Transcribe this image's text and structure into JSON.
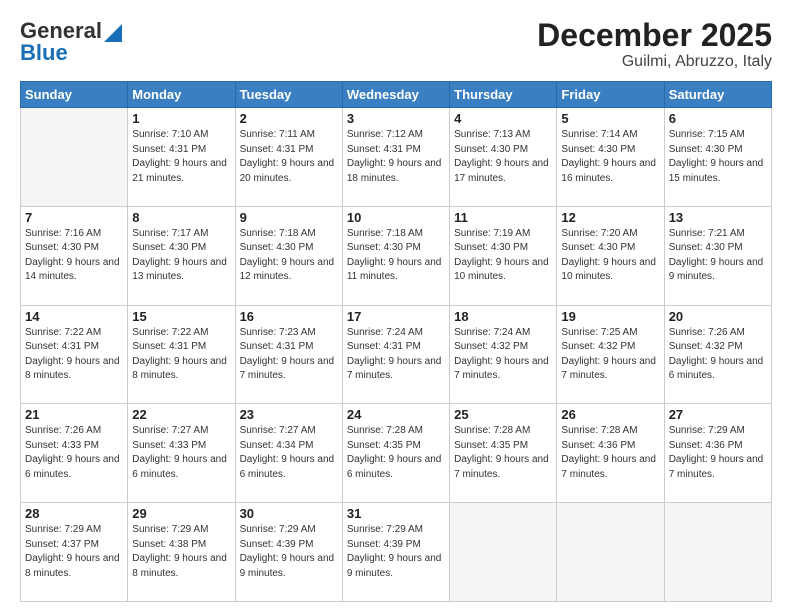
{
  "header": {
    "logo_general": "General",
    "logo_blue": "Blue",
    "title": "December 2025",
    "subtitle": "Guilmi, Abruzzo, Italy"
  },
  "days_of_week": [
    "Sunday",
    "Monday",
    "Tuesday",
    "Wednesday",
    "Thursday",
    "Friday",
    "Saturday"
  ],
  "weeks": [
    [
      {
        "day": "",
        "sunrise": "",
        "sunset": "",
        "daylight": ""
      },
      {
        "day": "1",
        "sunrise": "Sunrise: 7:10 AM",
        "sunset": "Sunset: 4:31 PM",
        "daylight": "Daylight: 9 hours and 21 minutes."
      },
      {
        "day": "2",
        "sunrise": "Sunrise: 7:11 AM",
        "sunset": "Sunset: 4:31 PM",
        "daylight": "Daylight: 9 hours and 20 minutes."
      },
      {
        "day": "3",
        "sunrise": "Sunrise: 7:12 AM",
        "sunset": "Sunset: 4:31 PM",
        "daylight": "Daylight: 9 hours and 18 minutes."
      },
      {
        "day": "4",
        "sunrise": "Sunrise: 7:13 AM",
        "sunset": "Sunset: 4:30 PM",
        "daylight": "Daylight: 9 hours and 17 minutes."
      },
      {
        "day": "5",
        "sunrise": "Sunrise: 7:14 AM",
        "sunset": "Sunset: 4:30 PM",
        "daylight": "Daylight: 9 hours and 16 minutes."
      },
      {
        "day": "6",
        "sunrise": "Sunrise: 7:15 AM",
        "sunset": "Sunset: 4:30 PM",
        "daylight": "Daylight: 9 hours and 15 minutes."
      }
    ],
    [
      {
        "day": "7",
        "sunrise": "Sunrise: 7:16 AM",
        "sunset": "Sunset: 4:30 PM",
        "daylight": "Daylight: 9 hours and 14 minutes."
      },
      {
        "day": "8",
        "sunrise": "Sunrise: 7:17 AM",
        "sunset": "Sunset: 4:30 PM",
        "daylight": "Daylight: 9 hours and 13 minutes."
      },
      {
        "day": "9",
        "sunrise": "Sunrise: 7:18 AM",
        "sunset": "Sunset: 4:30 PM",
        "daylight": "Daylight: 9 hours and 12 minutes."
      },
      {
        "day": "10",
        "sunrise": "Sunrise: 7:18 AM",
        "sunset": "Sunset: 4:30 PM",
        "daylight": "Daylight: 9 hours and 11 minutes."
      },
      {
        "day": "11",
        "sunrise": "Sunrise: 7:19 AM",
        "sunset": "Sunset: 4:30 PM",
        "daylight": "Daylight: 9 hours and 10 minutes."
      },
      {
        "day": "12",
        "sunrise": "Sunrise: 7:20 AM",
        "sunset": "Sunset: 4:30 PM",
        "daylight": "Daylight: 9 hours and 10 minutes."
      },
      {
        "day": "13",
        "sunrise": "Sunrise: 7:21 AM",
        "sunset": "Sunset: 4:30 PM",
        "daylight": "Daylight: 9 hours and 9 minutes."
      }
    ],
    [
      {
        "day": "14",
        "sunrise": "Sunrise: 7:22 AM",
        "sunset": "Sunset: 4:31 PM",
        "daylight": "Daylight: 9 hours and 8 minutes."
      },
      {
        "day": "15",
        "sunrise": "Sunrise: 7:22 AM",
        "sunset": "Sunset: 4:31 PM",
        "daylight": "Daylight: 9 hours and 8 minutes."
      },
      {
        "day": "16",
        "sunrise": "Sunrise: 7:23 AM",
        "sunset": "Sunset: 4:31 PM",
        "daylight": "Daylight: 9 hours and 7 minutes."
      },
      {
        "day": "17",
        "sunrise": "Sunrise: 7:24 AM",
        "sunset": "Sunset: 4:31 PM",
        "daylight": "Daylight: 9 hours and 7 minutes."
      },
      {
        "day": "18",
        "sunrise": "Sunrise: 7:24 AM",
        "sunset": "Sunset: 4:32 PM",
        "daylight": "Daylight: 9 hours and 7 minutes."
      },
      {
        "day": "19",
        "sunrise": "Sunrise: 7:25 AM",
        "sunset": "Sunset: 4:32 PM",
        "daylight": "Daylight: 9 hours and 7 minutes."
      },
      {
        "day": "20",
        "sunrise": "Sunrise: 7:26 AM",
        "sunset": "Sunset: 4:32 PM",
        "daylight": "Daylight: 9 hours and 6 minutes."
      }
    ],
    [
      {
        "day": "21",
        "sunrise": "Sunrise: 7:26 AM",
        "sunset": "Sunset: 4:33 PM",
        "daylight": "Daylight: 9 hours and 6 minutes."
      },
      {
        "day": "22",
        "sunrise": "Sunrise: 7:27 AM",
        "sunset": "Sunset: 4:33 PM",
        "daylight": "Daylight: 9 hours and 6 minutes."
      },
      {
        "day": "23",
        "sunrise": "Sunrise: 7:27 AM",
        "sunset": "Sunset: 4:34 PM",
        "daylight": "Daylight: 9 hours and 6 minutes."
      },
      {
        "day": "24",
        "sunrise": "Sunrise: 7:28 AM",
        "sunset": "Sunset: 4:35 PM",
        "daylight": "Daylight: 9 hours and 6 minutes."
      },
      {
        "day": "25",
        "sunrise": "Sunrise: 7:28 AM",
        "sunset": "Sunset: 4:35 PM",
        "daylight": "Daylight: 9 hours and 7 minutes."
      },
      {
        "day": "26",
        "sunrise": "Sunrise: 7:28 AM",
        "sunset": "Sunset: 4:36 PM",
        "daylight": "Daylight: 9 hours and 7 minutes."
      },
      {
        "day": "27",
        "sunrise": "Sunrise: 7:29 AM",
        "sunset": "Sunset: 4:36 PM",
        "daylight": "Daylight: 9 hours and 7 minutes."
      }
    ],
    [
      {
        "day": "28",
        "sunrise": "Sunrise: 7:29 AM",
        "sunset": "Sunset: 4:37 PM",
        "daylight": "Daylight: 9 hours and 8 minutes."
      },
      {
        "day": "29",
        "sunrise": "Sunrise: 7:29 AM",
        "sunset": "Sunset: 4:38 PM",
        "daylight": "Daylight: 9 hours and 8 minutes."
      },
      {
        "day": "30",
        "sunrise": "Sunrise: 7:29 AM",
        "sunset": "Sunset: 4:39 PM",
        "daylight": "Daylight: 9 hours and 9 minutes."
      },
      {
        "day": "31",
        "sunrise": "Sunrise: 7:29 AM",
        "sunset": "Sunset: 4:39 PM",
        "daylight": "Daylight: 9 hours and 9 minutes."
      },
      {
        "day": "",
        "sunrise": "",
        "sunset": "",
        "daylight": ""
      },
      {
        "day": "",
        "sunrise": "",
        "sunset": "",
        "daylight": ""
      },
      {
        "day": "",
        "sunrise": "",
        "sunset": "",
        "daylight": ""
      }
    ]
  ]
}
